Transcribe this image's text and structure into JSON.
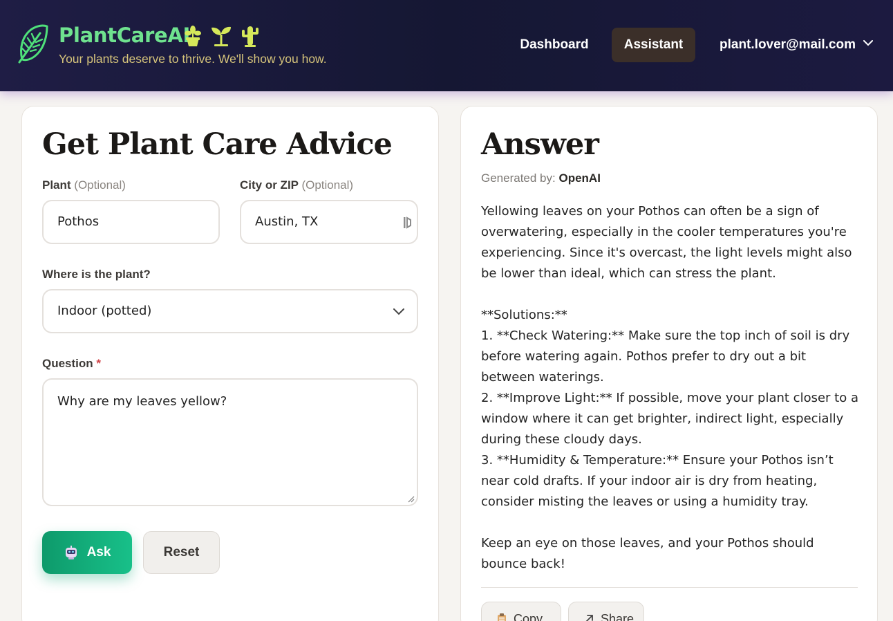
{
  "header": {
    "brand_title": "PlantCareAI",
    "tagline": "Your plants deserve to thrive. We'll show you how.",
    "brand_icons": [
      "potted-plant-icon",
      "seedling-icon",
      "cactus-icon"
    ],
    "nav": {
      "dashboard": "Dashboard",
      "assistant": "Assistant"
    },
    "user_email": "plant.lover@mail.com"
  },
  "form": {
    "title": "Get Plant Care Advice",
    "plant_label": "Plant",
    "plant_optional": "(Optional)",
    "plant_value": "Pothos",
    "city_label": "City or ZIP",
    "city_optional": "(Optional)",
    "city_value": "Austin, TX",
    "location_label": "Where is the plant?",
    "location_value": "Indoor (potted)",
    "question_label": "Question",
    "question_required": "*",
    "question_value": "Why are my leaves yellow?",
    "ask_label": "Ask",
    "reset_label": "Reset"
  },
  "answer": {
    "title": "Answer",
    "generated_by_label": "Generated by:",
    "generated_by_value": "OpenAI",
    "text": "Yellowing leaves on your Pothos can often be a sign of overwatering, especially in the cooler temperatures you're experiencing. Since it's overcast, the light levels might also be lower than ideal, which can stress the plant.\n\n**Solutions:**\n1. **Check Watering:** Make sure the top inch of soil is dry before watering again. Pothos prefer to dry out a bit between waterings.\n2. **Improve Light:** If possible, move your plant closer to a window where it can get brighter, indirect light, especially during these cloudy days.\n3. **Humidity & Temperature:** Ensure your Pothos isn’t near cold drafts. If your indoor air is dry from heating, consider misting the leaves or using a humidity tray.\n\nKeep an eye on those leaves, and your Pothos should bounce back!",
    "copy_label": "Copy",
    "share_label": "Share"
  },
  "colors": {
    "header_bg": "#1a1a3e",
    "brand_green": "#6fe28f",
    "tagline_gold": "#d6c47b",
    "assistant_active_bg": "#3b2f29",
    "ask_button": "#13b07c",
    "required_red": "#d0464a"
  }
}
